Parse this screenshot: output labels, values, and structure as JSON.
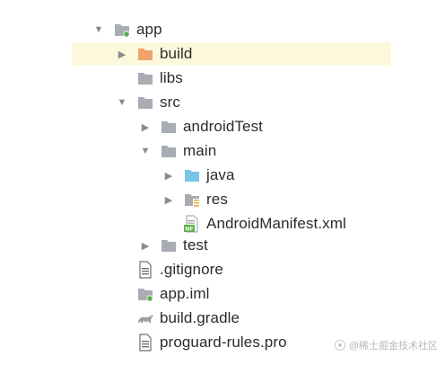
{
  "colors": {
    "folder": "#a8adb3",
    "folder_build": "#f0a26b",
    "folder_java": "#79c3e6",
    "module_dot": "#59b04b",
    "selection": "#fcf8dc",
    "text": "#2b2b2b",
    "arrow": "#8a8a8a"
  },
  "tree": [
    {
      "label": "app",
      "icon": "module-folder-icon",
      "arrow": "expanded"
    },
    {
      "label": "build",
      "icon": "build-folder-icon",
      "arrow": "collapsed",
      "selected": true
    },
    {
      "label": "libs",
      "icon": "folder-icon",
      "arrow": "none"
    },
    {
      "label": "src",
      "icon": "folder-icon",
      "arrow": "expanded"
    },
    {
      "label": "androidTest",
      "icon": "folder-icon",
      "arrow": "collapsed"
    },
    {
      "label": "main",
      "icon": "folder-icon",
      "arrow": "expanded"
    },
    {
      "label": "java",
      "icon": "source-folder-icon",
      "arrow": "collapsed"
    },
    {
      "label": "res",
      "icon": "resource-folder-icon",
      "arrow": "collapsed"
    },
    {
      "label": "AndroidManifest.xml",
      "icon": "manifest-file-icon",
      "arrow": "none"
    },
    {
      "label": "test",
      "icon": "folder-icon",
      "arrow": "collapsed"
    },
    {
      "label": ".gitignore",
      "icon": "text-file-icon",
      "arrow": "none"
    },
    {
      "label": "app.iml",
      "icon": "module-file-icon",
      "arrow": "none"
    },
    {
      "label": "build.gradle",
      "icon": "gradle-icon",
      "arrow": "none"
    },
    {
      "label": "proguard-rules.pro",
      "icon": "text-file-icon",
      "arrow": "none"
    }
  ],
  "watermark": "@稀土掘金技术社区"
}
